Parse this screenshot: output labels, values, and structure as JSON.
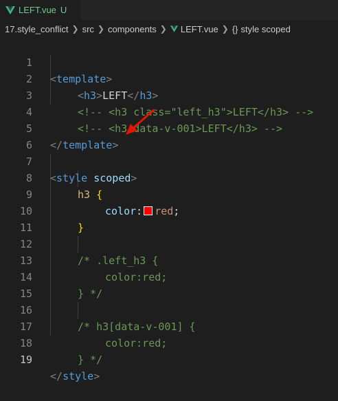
{
  "tab": {
    "filename": "LEFT.vue",
    "status": "U"
  },
  "breadcrumb": {
    "items": [
      "17.style_conflict",
      "src",
      "components",
      "LEFT.vue"
    ],
    "symbol": "style scoped"
  },
  "editor": {
    "active_line": 19,
    "lines": [
      {
        "num": "1"
      },
      {
        "num": "2"
      },
      {
        "num": "3"
      },
      {
        "num": "4"
      },
      {
        "num": "5"
      },
      {
        "num": "6"
      },
      {
        "num": "7"
      },
      {
        "num": "8"
      },
      {
        "num": "9"
      },
      {
        "num": "10"
      },
      {
        "num": "11"
      },
      {
        "num": "12"
      },
      {
        "num": "13"
      },
      {
        "num": "14"
      },
      {
        "num": "15"
      },
      {
        "num": "16"
      },
      {
        "num": "17"
      },
      {
        "num": "18"
      },
      {
        "num": "19"
      }
    ],
    "tokens": {
      "template": "template",
      "h3": "h3",
      "left": "LEFT",
      "comment1": "<!-- <h3 class=\"left_h3\">LEFT</h3> -->",
      "comment2": "<!-- <h3 data-v-001>LEFT</h3> -->",
      "style": "style",
      "scoped": "scoped",
      "selector": "h3",
      "open_brace": "{",
      "close_brace": "}",
      "prop": "color",
      "value": "red",
      "c12": "/* .left_h3 {",
      "c13": "color:red;",
      "c14": "} */",
      "c16": "/* h3[data-v-001] {",
      "c17": "color:red;",
      "c18": "} */"
    }
  },
  "colors": {
    "background": "#1e1e1e",
    "tag": "#569cd6",
    "comment": "#6a9955",
    "swatch": "#ff0000",
    "arrow": "#e51400"
  }
}
